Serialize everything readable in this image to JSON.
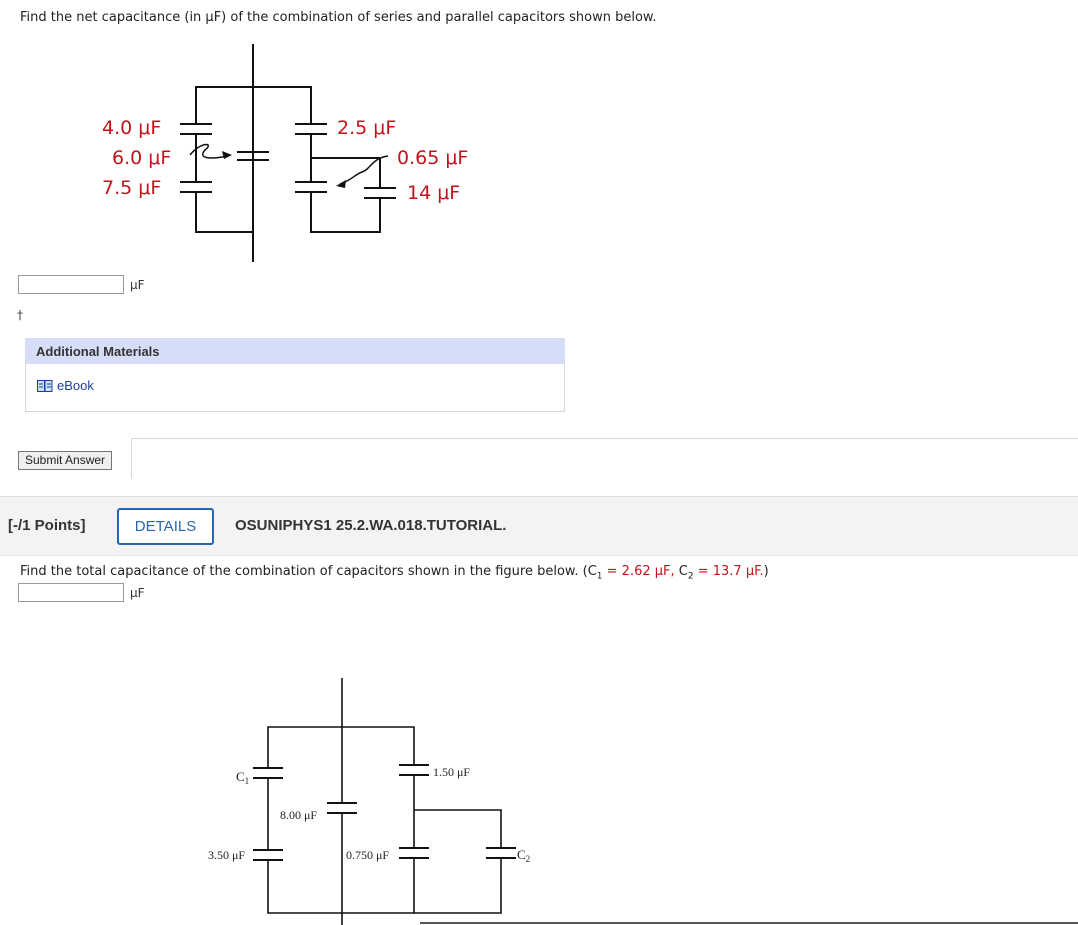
{
  "question1": {
    "prompt": "Find the net capacitance (in μF) of the combination of series and parallel capacitors shown below.",
    "circuit_labels": {
      "c_4_0": "4.0 μF",
      "c_6_0": "6.0 μF",
      "c_7_5": "7.5 μF",
      "c_2_5": "2.5 μF",
      "c_0_65": "0.65 μF",
      "c_14": "14 μF"
    },
    "answer_value": "",
    "unit": "μF",
    "dagger": "†"
  },
  "additional_materials": {
    "title": "Additional Materials",
    "ebook_label": "eBook"
  },
  "submit_label": "Submit Answer",
  "question2_header": {
    "points": "[-/1 Points]",
    "details_label": "DETAILS",
    "question_id": "OSUNIPHYS1 25.2.WA.018.TUTORIAL."
  },
  "question2": {
    "prompt_start": "Find the total capacitance of the combination of capacitors shown in the figure below. (",
    "c1_symbol": "C",
    "c1_sub": "1",
    "c1_value": " = 2.62 μF, ",
    "c2_symbol": "C",
    "c2_sub": "2",
    "c2_value": " = 13.7 μF.",
    "prompt_end": ")",
    "answer_value": "",
    "unit": "μF",
    "circuit_labels": {
      "c1": "C",
      "c1_sub": "1",
      "c_1_50": "1.50 μF",
      "c_8_00": "8.00 μF",
      "c_3_50": "3.50 μF",
      "c_0_750": "0.750 μF",
      "c2": "C",
      "c2_sub": "2"
    }
  }
}
